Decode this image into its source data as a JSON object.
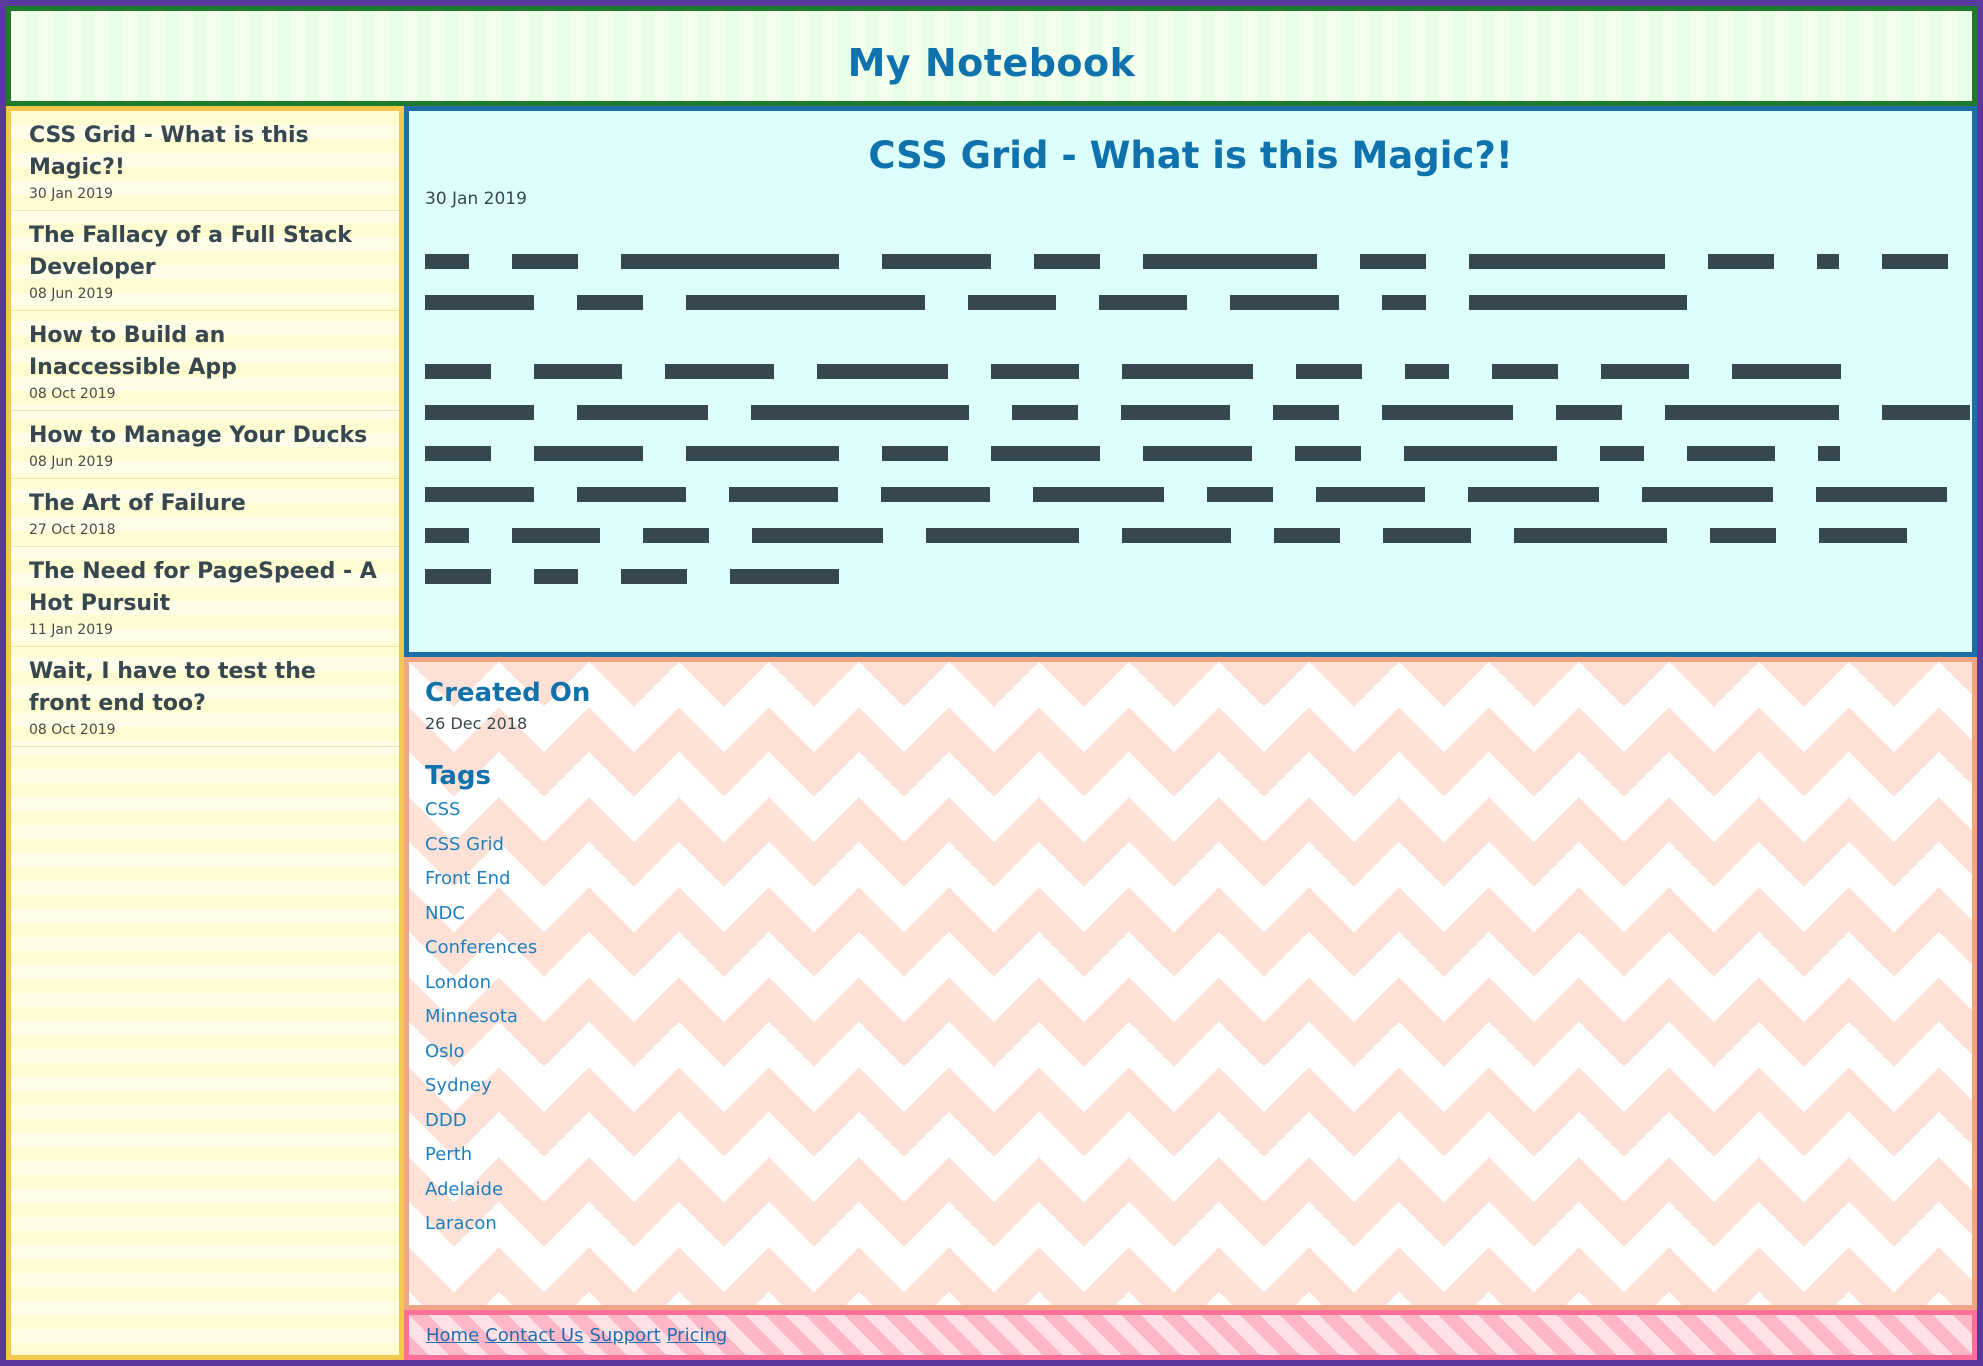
{
  "header": {
    "title": "My Notebook"
  },
  "sidebar": {
    "posts": [
      {
        "title": "CSS Grid - What is this Magic?!",
        "date": "30 Jan 2019"
      },
      {
        "title": "The Fallacy of a Full Stack Developer",
        "date": "08 Jun 2019"
      },
      {
        "title": "How to Build an Inaccessible App",
        "date": "08 Oct 2019"
      },
      {
        "title": "How to Manage Your Ducks",
        "date": "08 Jun 2019"
      },
      {
        "title": "The Art of Failure",
        "date": "27 Oct 2018"
      },
      {
        "title": "The Need for PageSpeed - A Hot Pursuit",
        "date": "11 Jan 2019"
      },
      {
        "title": "Wait, I have to test the front end too?",
        "date": "08 Oct 2019"
      }
    ]
  },
  "article": {
    "title": "CSS Grid - What is this Magic?!",
    "date": "30 Jan 2019"
  },
  "meta": {
    "created_heading": "Created On",
    "created_date": "26 Dec 2018",
    "tags_heading": "Tags",
    "tags": [
      "CSS",
      "CSS Grid",
      "Front End",
      "NDC",
      "Conferences",
      "London",
      "Minnesota",
      "Oslo",
      "Sydney",
      "DDD",
      "Perth",
      "Adelaide",
      "Laracon"
    ]
  },
  "footer": {
    "links": [
      "Home",
      "Contact Us",
      "Support",
      "Pricing"
    ]
  },
  "colors": {
    "accent": "#0f72ad",
    "text": "#37474f",
    "header_border": "#1f7a2e",
    "sidebar_border": "#f2c94c",
    "article_border": "#1d6fa6",
    "meta_border": "#f1a385",
    "footer_border": "#ff6f9a",
    "page_border": "#5b3a9e"
  },
  "icons": []
}
